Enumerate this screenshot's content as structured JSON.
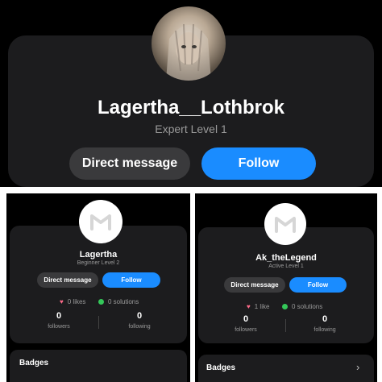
{
  "top": {
    "username": "Lagertha__Lothbrok",
    "level": "Expert Level 1",
    "direct_message": "Direct message",
    "follow": "Follow"
  },
  "left": {
    "username": "Lagertha",
    "level": "Beginner Level 2",
    "direct_message": "Direct message",
    "follow": "Follow",
    "likes": "0 likes",
    "solutions": "0 solutions",
    "followers_count": "0",
    "followers_label": "followers",
    "following_count": "0",
    "following_label": "following",
    "badges": "Badges"
  },
  "right": {
    "username": "Ak_theLegend",
    "level": "Active Level 1",
    "direct_message": "Direct message",
    "follow": "Follow",
    "likes": "1 like",
    "solutions": "0 solutions",
    "followers_count": "0",
    "followers_label": "followers",
    "following_count": "0",
    "following_label": "following",
    "badges": "Badges"
  },
  "icons": {
    "heart": "heart-icon",
    "check": "check-circle-icon",
    "chevron": "chevron-right-icon",
    "logo": "m-logo-icon"
  },
  "colors": {
    "follow": "#1a8cff",
    "direct_message": "#3a3a3c",
    "card": "#1c1c1e",
    "heart": "#ff6b8a",
    "check": "#34c759"
  }
}
